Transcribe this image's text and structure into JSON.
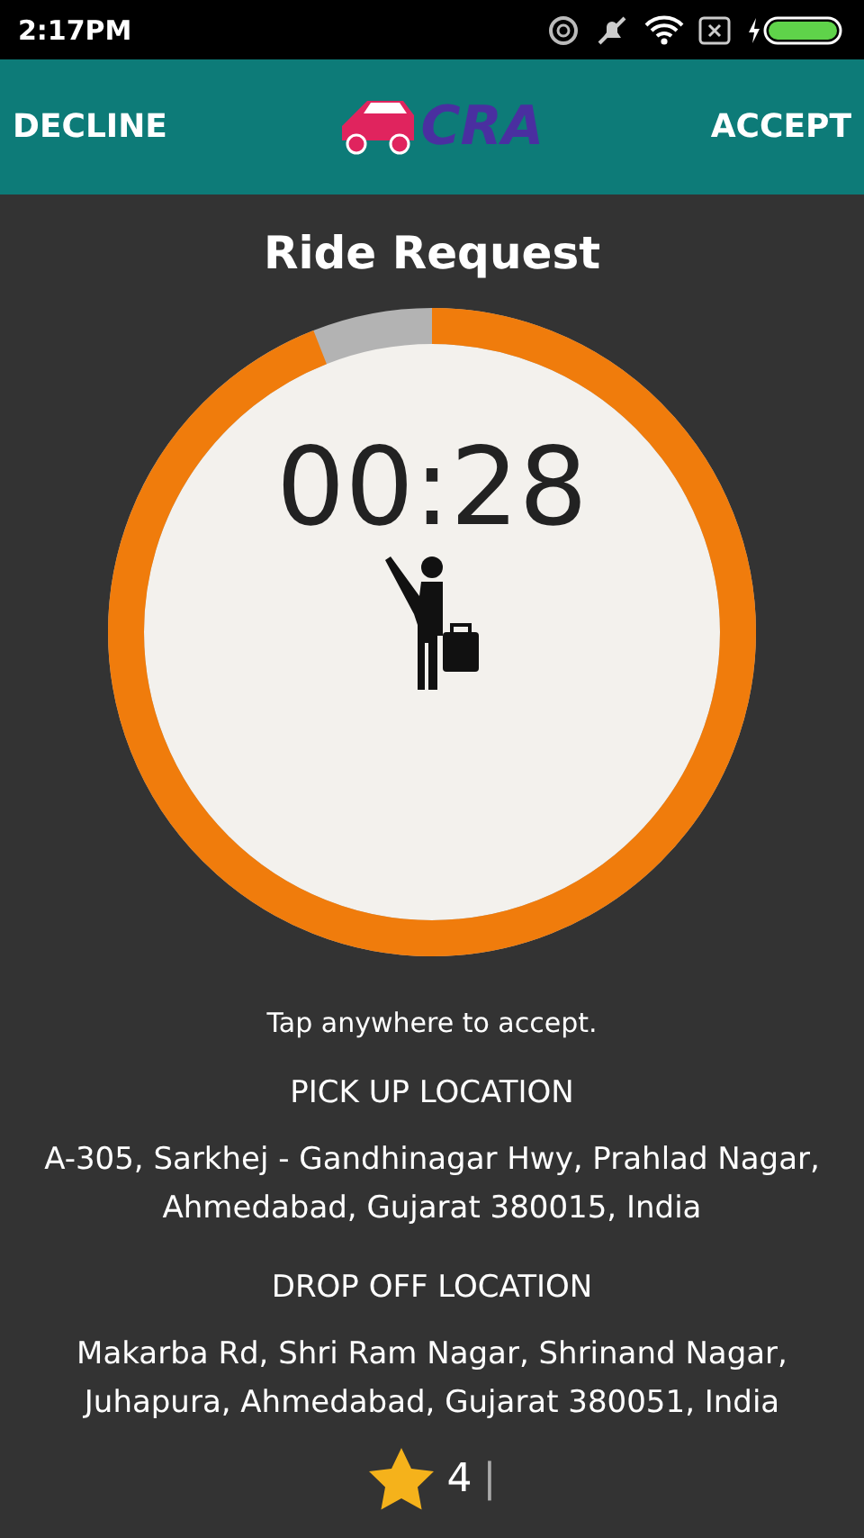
{
  "status_bar": {
    "time": "2:17PM"
  },
  "header": {
    "decline": "DECLINE",
    "logo_text": "CRA",
    "accept": "ACCEPT"
  },
  "title": "Ride Request",
  "timer": {
    "time": "00:28",
    "level": 0.94
  },
  "hint": "Tap anywhere to accept.",
  "pickup": {
    "label": "PICK UP LOCATION",
    "address": "A-305, Sarkhej - Gandhinagar Hwy, Prahlad Nagar, Ahmedabad, Gujarat 380015, India"
  },
  "dropoff": {
    "label": "DROP OFF LOCATION",
    "address": "Makarba Rd, Shri Ram Nagar, Shrinand Nagar, Juhapura, Ahmedabad, Gujarat 380051, India"
  },
  "rating": {
    "value": "4",
    "separator": "|"
  }
}
